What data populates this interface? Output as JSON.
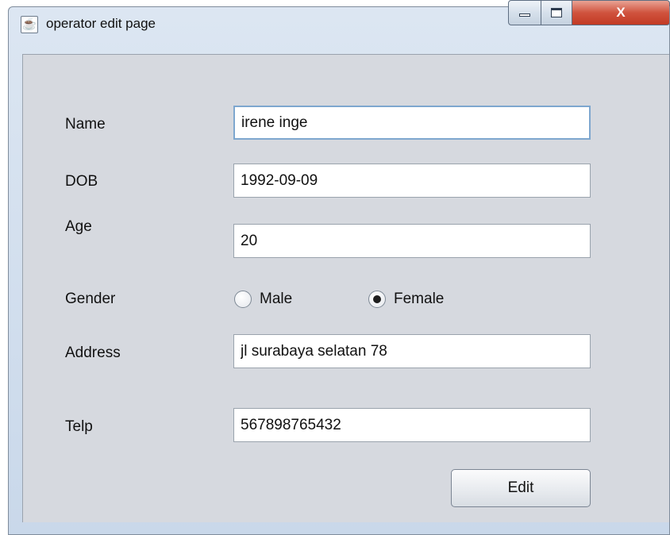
{
  "window": {
    "title": "operator edit page",
    "controls": {
      "minimize": "",
      "maximize": "",
      "close": "X"
    }
  },
  "form": {
    "name_label": "Name",
    "name_value": "irene inge",
    "dob_label": "DOB",
    "dob_value": "1992-09-09",
    "age_label": "Age",
    "age_value": "20",
    "gender_label": "Gender",
    "gender_options": [
      {
        "label": "Male",
        "selected": false
      },
      {
        "label": "Female",
        "selected": true
      }
    ],
    "address_label": "Address",
    "address_value": "jl surabaya selatan 78",
    "telp_label": "Telp",
    "telp_value": "567898765432",
    "edit_button": "Edit"
  },
  "icons": {
    "app": "java-icon",
    "minimize": "minimize-icon",
    "maximize": "maximize-icon",
    "close": "close-icon"
  }
}
